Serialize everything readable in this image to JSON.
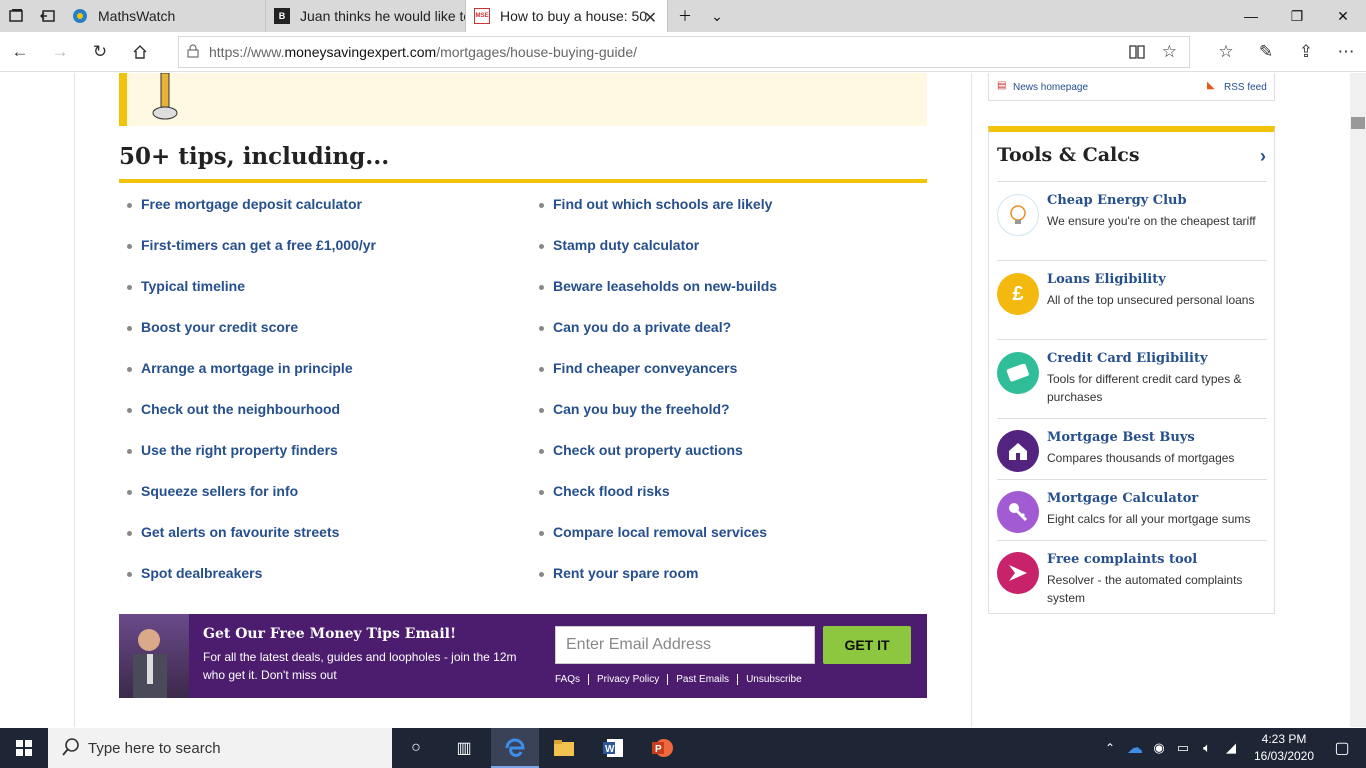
{
  "browser": {
    "tabs": [
      {
        "title": "MathsWatch",
        "active": false
      },
      {
        "title": "Juan thinks he would like to",
        "active": false
      },
      {
        "title": "How to buy a house: 50",
        "active": true
      }
    ],
    "url_prefix": "https://www.",
    "url_host": "moneysavingexpert.com",
    "url_path": "/mortgages/house-buying-guide/"
  },
  "main": {
    "tips_title": "50+ tips, including...",
    "tips_left": [
      "Free mortgage deposit calculator",
      "First-timers can get a free £1,000/yr",
      "Typical timeline",
      "Boost your credit score",
      "Arrange a mortgage in principle",
      "Check out the neighbourhood",
      "Use the right property finders",
      "Squeeze sellers for info",
      "Get alerts on favourite streets",
      "Spot dealbreakers"
    ],
    "tips_right": [
      "Find out which schools are likely",
      "Stamp duty calculator",
      "Beware leaseholds on new-builds",
      "Can you do a private deal?",
      "Find cheaper conveyancers",
      "Can you buy the freehold?",
      "Check out property auctions",
      "Check flood risks",
      "Compare local removal services",
      "Rent your spare room"
    ],
    "email_signup": {
      "title": "Get Our Free Money Tips Email!",
      "description": "For all the latest deals, guides and loopholes - join the 12m who get it. Don't miss out",
      "input_placeholder": "Enter Email Address",
      "button_label": "GET IT",
      "links": [
        "FAQs",
        "Privacy Policy",
        "Past Emails",
        "Unsubscribe"
      ]
    }
  },
  "sidebar": {
    "news_homepage": "News homepage",
    "rss_feed": "RSS feed",
    "tools_title": "Tools & Calcs",
    "tools": [
      {
        "name": "Cheap Energy Club",
        "desc": "We ensure you're on the cheapest tariff",
        "color": "#e8f4fb",
        "icon": "lightbulb-icon"
      },
      {
        "name": "Loans Eligibility",
        "desc": "All of the top unsecured personal loans",
        "color": "#f3b90f",
        "icon": "pound-icon"
      },
      {
        "name": "Credit Card Eligibility",
        "desc": "Tools for different credit card types & purchases",
        "color": "#2fbe98",
        "icon": "credit-card-icon"
      },
      {
        "name": "Mortgage Best Buys",
        "desc": "Compares thousands of mortgages",
        "color": "#52237f",
        "icon": "house-icon"
      },
      {
        "name": "Mortgage Calculator",
        "desc": "Eight calcs for all your mortgage sums",
        "color": "#a25bd3",
        "icon": "key-icon"
      },
      {
        "name": "Free complaints tool",
        "desc": "Resolver - the automated complaints system",
        "color": "#c8236a",
        "icon": "resolver-icon"
      }
    ]
  },
  "taskbar": {
    "search_placeholder": "Type here to search",
    "time": "4:23 PM",
    "date": "16/03/2020"
  }
}
